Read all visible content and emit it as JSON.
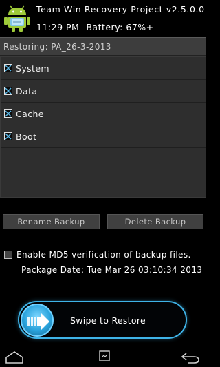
{
  "header": {
    "title": "Team Win Recovery Project  v2.5.0.0",
    "time": "11:29 PM",
    "battery": "Battery: 67%+"
  },
  "restore": {
    "label": "Restoring: PA_26-3-2013"
  },
  "partitions": [
    {
      "label": "System",
      "checked": true
    },
    {
      "label": "Data",
      "checked": true
    },
    {
      "label": "Cache",
      "checked": true
    },
    {
      "label": "Boot",
      "checked": true
    }
  ],
  "buttons": {
    "rename": "Rename Backup",
    "delete": "Delete Backup"
  },
  "md5": {
    "label": "Enable MD5 verification of backup files.",
    "checked": false
  },
  "package_date": "Package Date: Tue Mar 26 03:10:34 2013",
  "swipe": {
    "label": "Swipe to Restore"
  },
  "colors": {
    "accent": "#3fb4e8",
    "android_green": "#9fcb3a"
  },
  "icons": {
    "logo": "android-twrp-logo-icon",
    "home": "home-icon",
    "log": "console-log-icon",
    "back": "back-icon"
  }
}
